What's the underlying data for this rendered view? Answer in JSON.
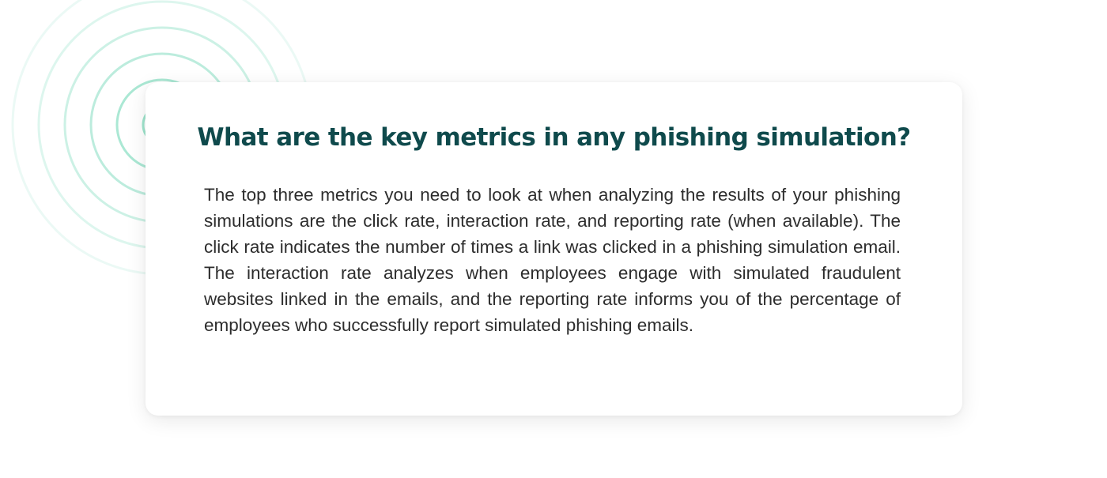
{
  "card": {
    "title": "What are the key metrics in any phishing simulation?",
    "body": "The top three metrics you need to look at when analyzing the results of your phishing simulations are the click rate, interaction rate, and reporting rate (when available). The click rate indicates the number of times a link was clicked in a phishing simulation email. The interaction rate analyzes when employees engage with simulated fraudulent websites linked in the emails, and the reporting rate informs you of the percentage of employees who successfully report simulated phishing emails."
  },
  "decoration": {
    "icon": "concentric-rings-icon",
    "ring_color": "#7fdcbf",
    "title_color": "#0f4a4c"
  }
}
